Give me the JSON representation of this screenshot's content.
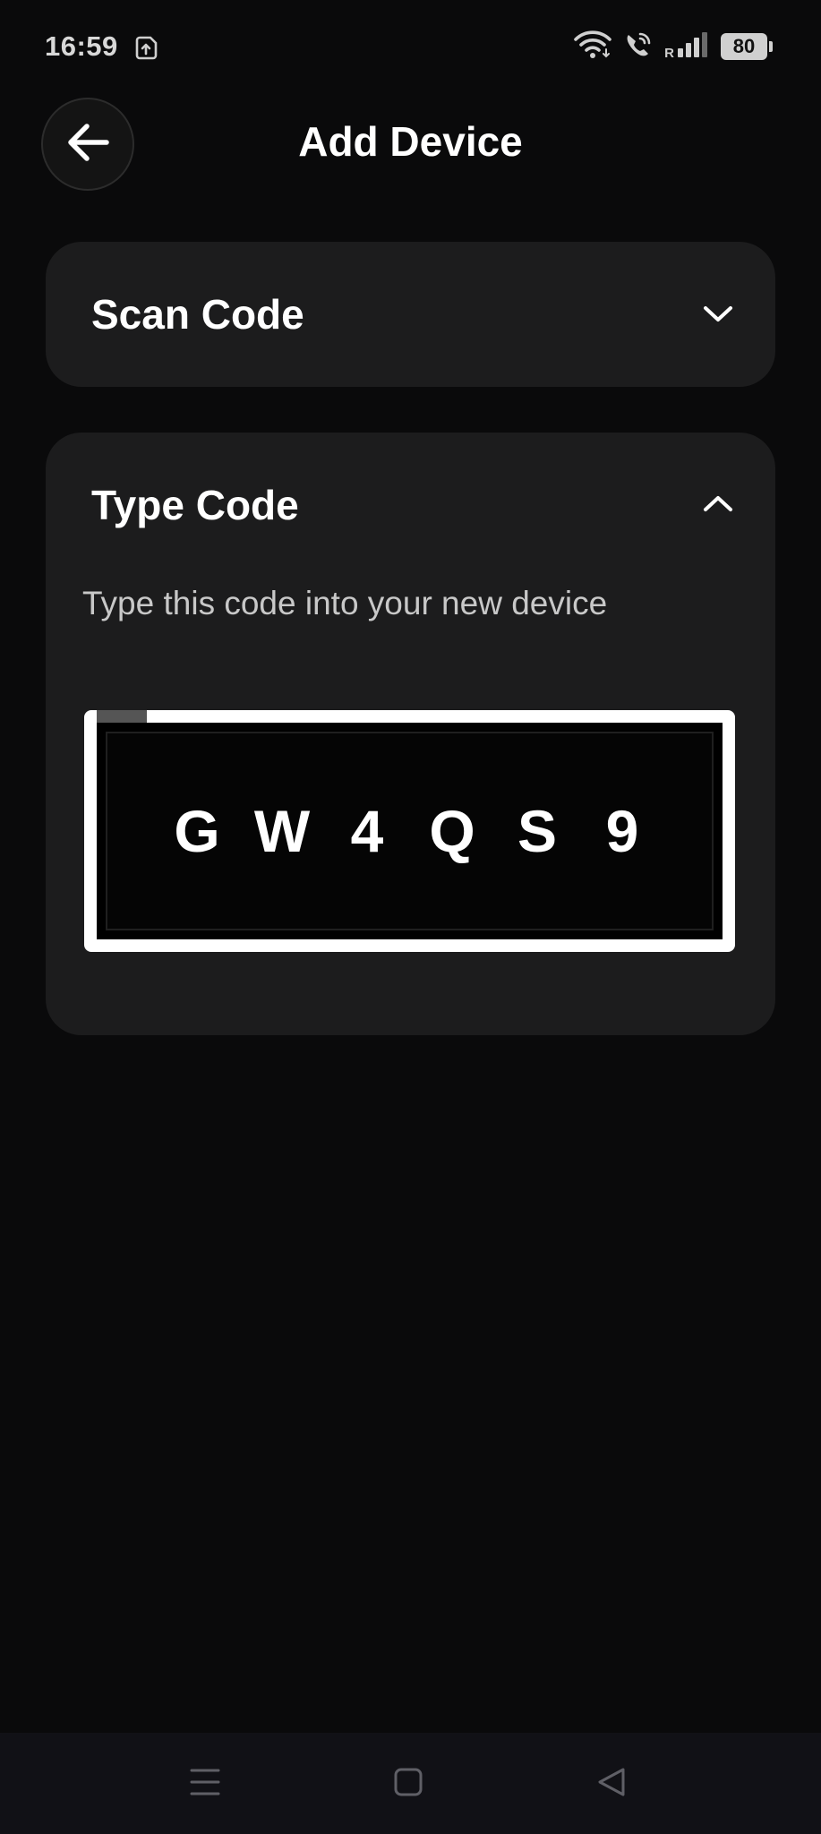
{
  "status_bar": {
    "time": "16:59",
    "roaming": "R",
    "battery": "80",
    "icons": [
      "screenshot-icon",
      "wifi-icon",
      "wifi-calling-icon",
      "signal-icon",
      "battery-icon"
    ]
  },
  "header": {
    "title": "Add Device",
    "back_icon": "arrow-left-icon"
  },
  "sections": {
    "scan": {
      "title": "Scan Code",
      "expanded": false,
      "icon": "chevron-down-icon"
    },
    "type": {
      "title": "Type Code",
      "expanded": true,
      "icon": "chevron-up-icon",
      "description": "Type this code into your new device",
      "code": [
        "G",
        "W",
        "4",
        "Q",
        "S",
        "9"
      ]
    }
  },
  "nav_bar": {
    "icons": [
      "menu-icon",
      "home-icon",
      "back-triangle-icon"
    ]
  },
  "colors": {
    "background": "#0a0a0b",
    "card": "#1c1c1d",
    "text": "#ffffff",
    "muted_text": "#c8c8c8",
    "nav_bar": "#111116"
  }
}
